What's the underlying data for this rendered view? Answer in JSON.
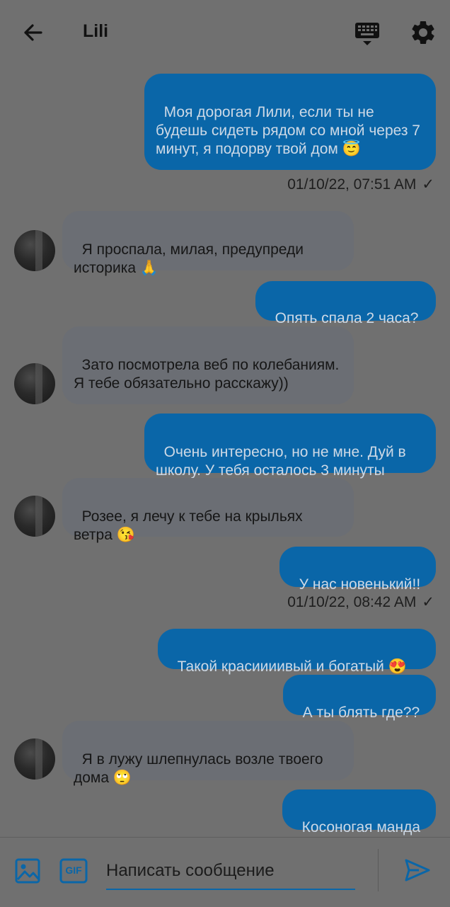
{
  "header": {
    "title": "Lili",
    "back_icon": "arrow-left-icon",
    "keyboard_icon": "keyboard-icon",
    "settings_icon": "gear-icon"
  },
  "messages": [
    {
      "side": "out",
      "text": "Моя дорогая Лили, если ты не будешь сидеть рядом со мной через 7 минут, я подорву твой дом 😇"
    },
    {
      "side": "meta",
      "text": "01/10/22, 07:51 AM"
    },
    {
      "side": "in",
      "text": "Я проспала, милая, предупреди историка 🙏"
    },
    {
      "side": "out",
      "text": "Опять спала 2 часа?"
    },
    {
      "side": "in",
      "text": "Зато посмотрела веб по колебаниям. Я тебе обязательно расскажу))"
    },
    {
      "side": "out",
      "text": "Очень интересно, но не мне. Дуй в школу. У тебя осталось 3 минуты"
    },
    {
      "side": "in",
      "text": "Розее, я лечу к тебе на крыльях ветра 😘"
    },
    {
      "side": "out",
      "text": "У нас новенький!!"
    },
    {
      "side": "meta",
      "text": "01/10/22, 08:42 AM"
    },
    {
      "side": "out",
      "text": "Такой красиииивый и богатый 😍"
    },
    {
      "side": "out",
      "text": "А ты блять где??"
    },
    {
      "side": "in",
      "text": "Я в лужу шлепнулась возле твоего дома 🙄"
    },
    {
      "side": "out",
      "text": "Косоногая манда"
    }
  ],
  "composer": {
    "placeholder": "Написать сообщение",
    "image_icon": "image-icon",
    "gif_label": "GIF",
    "send_icon": "send-icon"
  },
  "colors": {
    "outgoing_bubble": "#0a66a8",
    "incoming_bubble": "#6b6e74",
    "background": "#707070"
  }
}
